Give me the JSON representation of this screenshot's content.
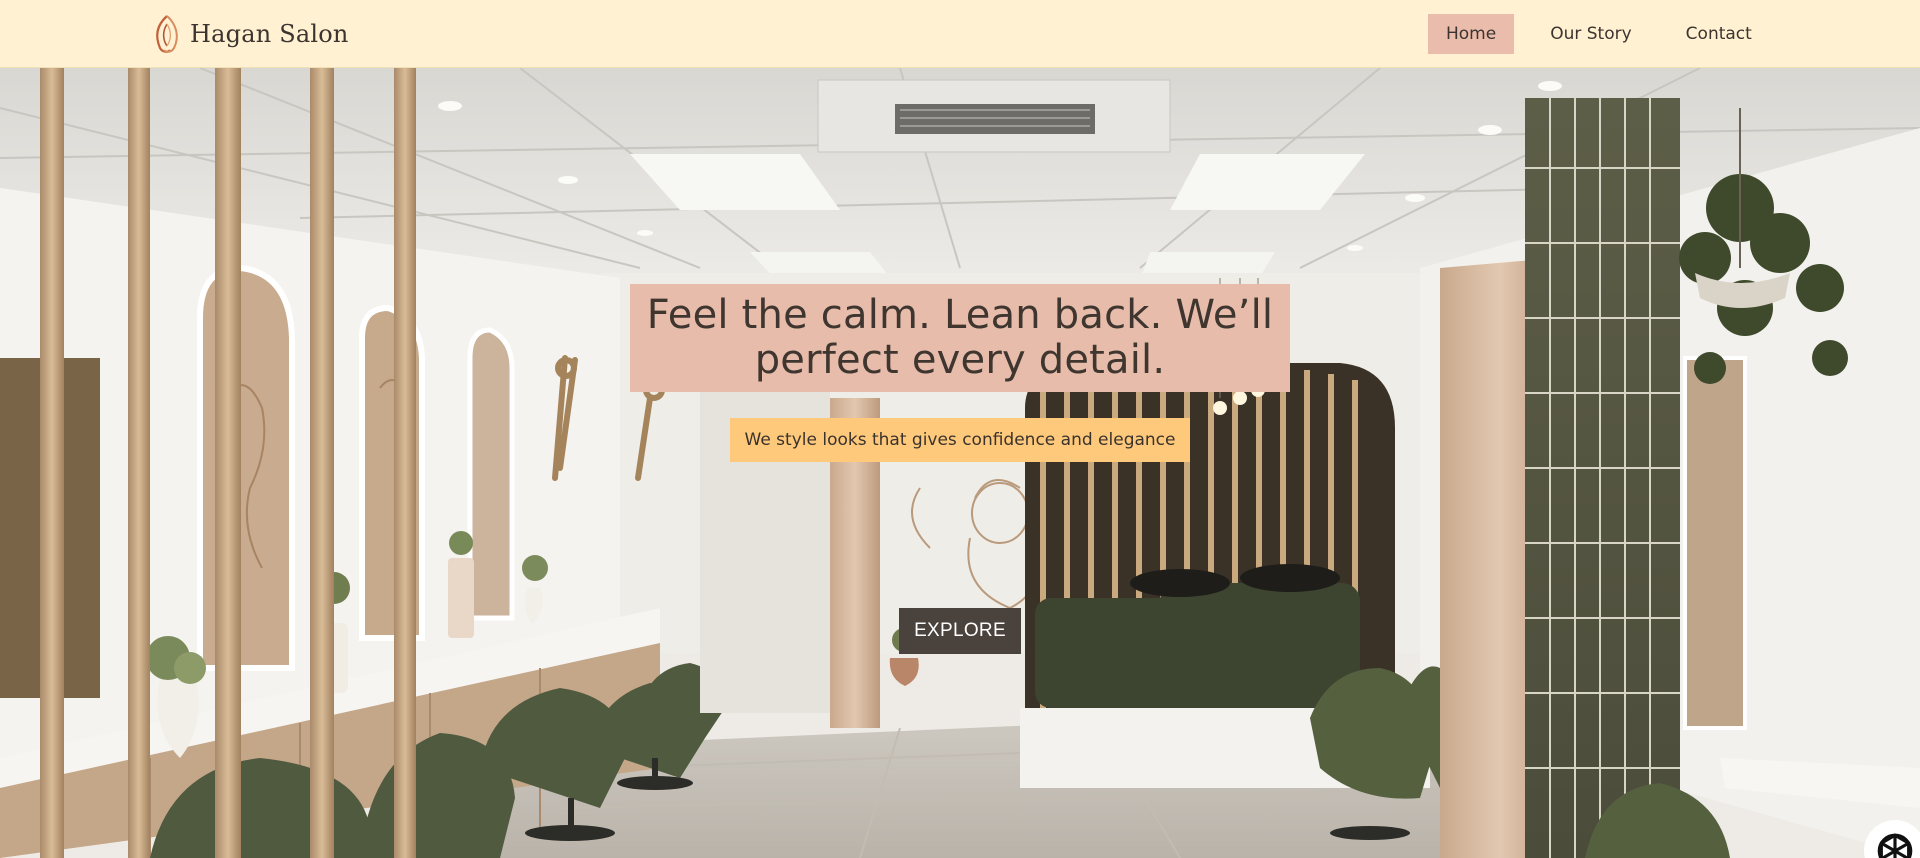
{
  "brand": {
    "name": "Hagan Salon",
    "logo_icon": "flame-leaf-icon",
    "logo_color": "#c2603a"
  },
  "nav": {
    "items": [
      {
        "label": "Home",
        "active": true
      },
      {
        "label": "Our Story",
        "active": false
      },
      {
        "label": "Contact",
        "active": false
      }
    ]
  },
  "hero": {
    "headline": "Feel the calm. Lean back. We’ll perfect every detail.",
    "subheadline": "We style looks that gives confidence and elegance",
    "cta_label": "EXPLORE",
    "background_image": "salon-interior-photo"
  },
  "chat": {
    "icon": "chat-assistant-icon"
  },
  "colors": {
    "header_bg": "#fff1d1",
    "nav_active_bg": "#e9bcab",
    "headline_bg": "#e8bcab",
    "subheadline_bg": "#fec97b",
    "cta_bg": "#4a423c",
    "text_dark": "#3c3430"
  }
}
